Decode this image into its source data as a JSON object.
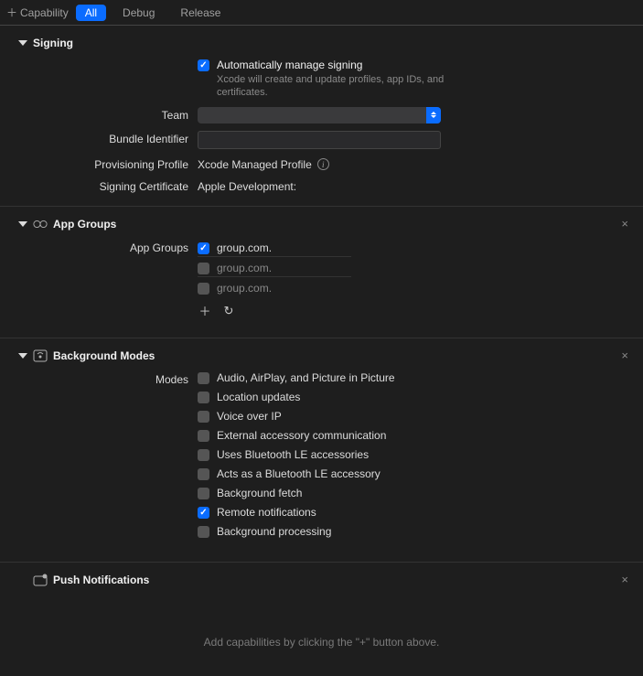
{
  "toolbar": {
    "capability_label": "Capability",
    "tabs": {
      "all": "All",
      "debug": "Debug",
      "release": "Release"
    }
  },
  "signing": {
    "title": "Signing",
    "auto_label": "Automatically manage signing",
    "auto_desc": "Xcode will create and update profiles, app IDs, and certificates.",
    "team_label": "Team",
    "bundle_label": "Bundle Identifier",
    "profile_label": "Provisioning Profile",
    "profile_value": "Xcode Managed Profile",
    "cert_label": "Signing Certificate",
    "cert_value": "Apple Development:"
  },
  "app_groups": {
    "title": "App Groups",
    "label": "App Groups",
    "items": [
      {
        "label": "group.com.",
        "checked": true
      },
      {
        "label": "group.com.",
        "checked": false
      },
      {
        "label": "group.com.",
        "checked": false
      }
    ]
  },
  "bg_modes": {
    "title": "Background Modes",
    "label": "Modes",
    "items": [
      {
        "label": "Audio, AirPlay, and Picture in Picture",
        "checked": false
      },
      {
        "label": "Location updates",
        "checked": false
      },
      {
        "label": "Voice over IP",
        "checked": false
      },
      {
        "label": "External accessory communication",
        "checked": false
      },
      {
        "label": "Uses Bluetooth LE accessories",
        "checked": false
      },
      {
        "label": "Acts as a Bluetooth LE accessory",
        "checked": false
      },
      {
        "label": "Background fetch",
        "checked": false
      },
      {
        "label": "Remote notifications",
        "checked": true
      },
      {
        "label": "Background processing",
        "checked": false
      }
    ]
  },
  "push": {
    "title": "Push Notifications"
  },
  "footer": {
    "hint": "Add capabilities by clicking the \"+\" button above."
  }
}
